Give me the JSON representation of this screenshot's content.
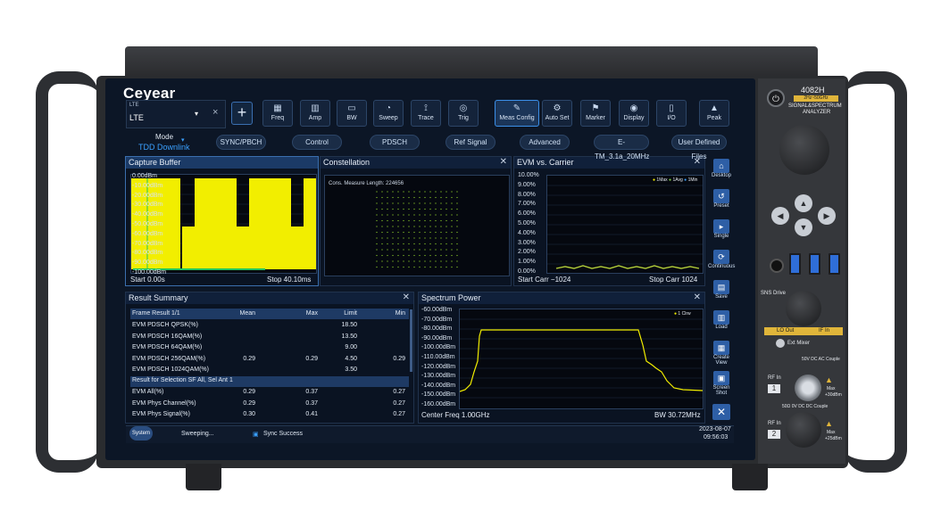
{
  "brand": "Ceyear",
  "model": {
    "name": "4082H",
    "range": "2Hz~50GHz",
    "subtitle1": "SIGNAL&SPECTRUM",
    "subtitle2": "ANALYZER"
  },
  "mode_select": {
    "app": "LTE",
    "label": "LTE"
  },
  "toolbar": [
    "Freq",
    "Amp",
    "BW",
    "Sweep",
    "Trace",
    "Trig",
    "Meas Config",
    "Auto Set",
    "Marker",
    "Display",
    "I/O",
    "Peak"
  ],
  "toolbar_active": "Meas Config",
  "mode": {
    "label": "Mode",
    "value": "TDD Downlink"
  },
  "subtabs": [
    "SYNC/PBCH",
    "Control",
    "PDSCH",
    "Ref Signal",
    "Advanced",
    "E-TM_3.1a_20MHz",
    "User Defined Files"
  ],
  "capture": {
    "title": "Capture Buffer",
    "yticks": [
      "0.00dBm",
      "-10.00dBm",
      "-20.00dBm",
      "-30.00dBm",
      "-40.00dBm",
      "-50.00dBm",
      "-60.00dBm",
      "-70.00dBm",
      "-80.00dBm",
      "-90.00dBm",
      "-100.00dBm"
    ],
    "start": "Start 0.00s",
    "stop": "Stop 40.10ms"
  },
  "constellation": {
    "title": "Constellation",
    "info": "Cons. Measure Length: 224656"
  },
  "evm": {
    "title": "EVM vs. Carrier",
    "yticks": [
      "10.00%",
      "9.00%",
      "8.00%",
      "7.00%",
      "6.00%",
      "5.00%",
      "4.00%",
      "3.00%",
      "2.00%",
      "1.00%",
      "0.00%"
    ],
    "legend": [
      "1Max",
      "1Avg",
      "1Min"
    ],
    "start": "Start Carr −1024",
    "stop": "Stop Carr  1024"
  },
  "result": {
    "title": "Result Summary",
    "header": [
      "Frame Result 1/1",
      "Mean",
      "Max",
      "Limit",
      "Min"
    ],
    "rows": [
      [
        "EVM PDSCH QPSK(%)",
        "",
        "",
        "18.50",
        ""
      ],
      [
        "EVM PDSCH 16QAM(%)",
        "",
        "",
        "13.50",
        ""
      ],
      [
        "EVM PDSCH 64QAM(%)",
        "",
        "",
        "9.00",
        ""
      ],
      [
        "EVM PDSCH 256QAM(%)",
        "0.29",
        "0.29",
        "4.50",
        "0.29"
      ],
      [
        "EVM PDSCH 1024QAM(%)",
        "",
        "",
        "3.50",
        ""
      ]
    ],
    "section": "Result for Selection SF All, Sel Ant 1",
    "rows2": [
      [
        "EVM All(%)",
        "0.29",
        "0.37",
        "",
        "0.27"
      ],
      [
        "EVM Phys Channel(%)",
        "0.29",
        "0.37",
        "",
        "0.27"
      ],
      [
        "EVM Phys Signal(%)",
        "0.30",
        "0.41",
        "",
        "0.27"
      ]
    ]
  },
  "spectrum": {
    "title": "Spectrum Power",
    "yticks": [
      "-60.00dBm",
      "-70.00dBm",
      "-80.00dBm",
      "-90.00dBm",
      "-100.00dBm",
      "-110.00dBm",
      "-120.00dBm",
      "-130.00dBm",
      "-140.00dBm",
      "-150.00dBm",
      "-160.00dBm"
    ],
    "legend": "1 Clrw",
    "center": "Center Freq 1.00GHz",
    "bw": "BW 30.72MHz"
  },
  "right_menu": [
    "Desktop",
    "Preset",
    "Single",
    "Continuous",
    "Save",
    "Load",
    "Create View",
    "Screen Shot"
  ],
  "status": {
    "system": "System",
    "sweep": "Sweeping...",
    "sync": "Sync Success",
    "date": "2023-08-07",
    "time": "09:56:03"
  },
  "front_panel": {
    "sns": "SNS Drive",
    "lo_out": "LO Out",
    "if_in": "IF In",
    "ext_mixer": "Ext Mixer",
    "ac1": "50V  DC  AC Couple",
    "rf1": "RF In",
    "rf1_num": "1",
    "max1a": "Max",
    "max1b": "+30dBm",
    "ac2": "50Ω    0V DC DC Couple",
    "rf2": "RF In",
    "rf2_num": "2",
    "max2a": "Max",
    "max2b": "+25dBm"
  },
  "colors": {
    "trace": "#f2ee00",
    "accent": "#3b8fe8",
    "screen": "#0c1626"
  }
}
